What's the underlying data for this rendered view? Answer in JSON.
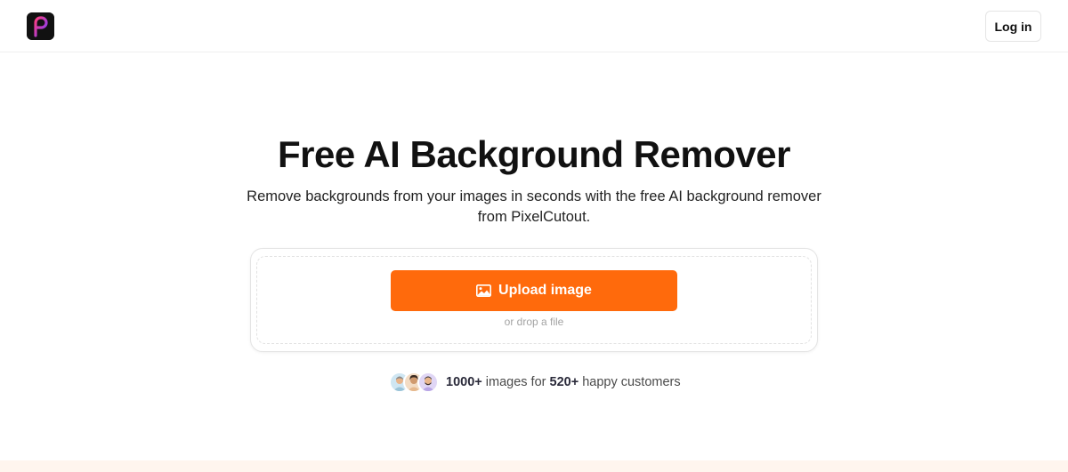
{
  "header": {
    "logo_name": "PixelCutout",
    "login_label": "Log in"
  },
  "hero": {
    "title": "Free AI Background Remover",
    "subtitle": "Remove backgrounds from your images in seconds with the free AI background remover from PixelCutout."
  },
  "upload": {
    "button_label": "Upload image",
    "button_icon": "image-icon",
    "drop_hint": "or drop a file"
  },
  "social_proof": {
    "images_count": "1000+",
    "images_text": "images for",
    "customers_count": "520+",
    "customers_text": "happy customers"
  },
  "colors": {
    "accent": "#ff6a0c",
    "logo_bg": "#111111",
    "logo_gradient_start": "#ff3d7f",
    "logo_gradient_end": "#7a3cff",
    "bottom_strip": "#fff5ee"
  }
}
